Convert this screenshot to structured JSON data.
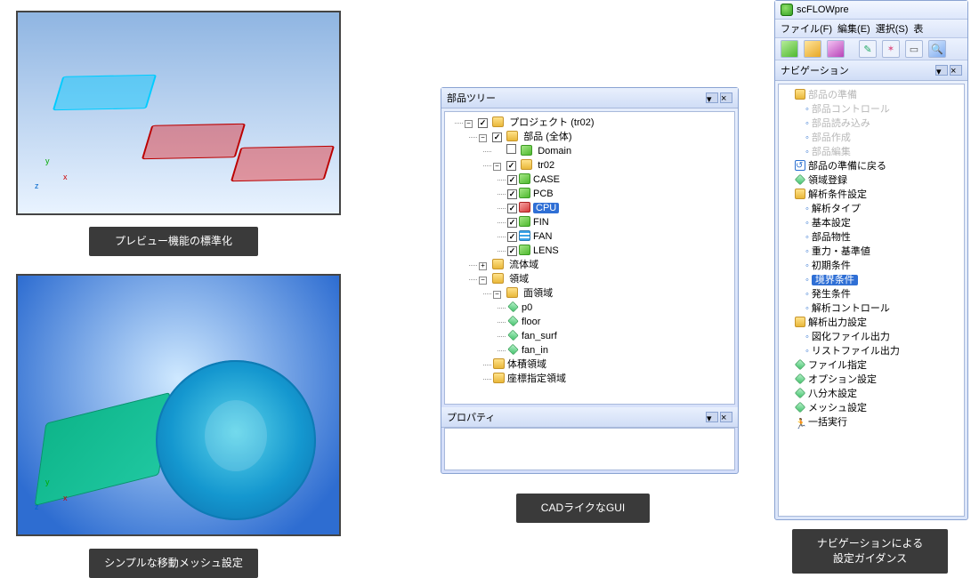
{
  "captions": {
    "preview": "プレビュー機能の標準化",
    "mesh": "シンプルな移動メッシュ設定",
    "cad": "CADライクなGUI",
    "nav": "ナビゲーションによる\n設定ガイダンス"
  },
  "tree_window": {
    "title": "部品ツリー",
    "property_title": "プロパティ",
    "root": {
      "label": "プロジェクト (tr02)",
      "checked": true,
      "children": {
        "parts": {
          "label": "部品 (全体)",
          "checked": true,
          "items": [
            {
              "label": "Domain",
              "checked": false,
              "icon": "cube"
            },
            {
              "label": "tr02",
              "checked": true,
              "icon": "folder",
              "children": [
                {
                  "label": "CASE",
                  "checked": true,
                  "icon": "cube"
                },
                {
                  "label": "PCB",
                  "checked": true,
                  "icon": "cube"
                },
                {
                  "label": "CPU",
                  "checked": true,
                  "icon": "cube.red",
                  "selected": true
                },
                {
                  "label": "FIN",
                  "checked": true,
                  "icon": "cube"
                },
                {
                  "label": "FAN",
                  "checked": true,
                  "icon": "wave"
                },
                {
                  "label": "LENS",
                  "checked": true,
                  "icon": "cube"
                }
              ]
            }
          ]
        },
        "fluid": {
          "label": "流体域"
        },
        "region": {
          "label": "領域",
          "surface": {
            "label": "面領域",
            "items": [
              {
                "label": "p0"
              },
              {
                "label": "floor"
              },
              {
                "label": "fan_surf"
              },
              {
                "label": "fan_in"
              }
            ]
          },
          "volume": {
            "label": "体積領域"
          },
          "coord": {
            "label": "座標指定領域"
          }
        }
      }
    }
  },
  "nav_window": {
    "app_title": "scFLOWpre",
    "menu": [
      "ファイル(F)",
      "編集(E)",
      "選択(S)",
      "表"
    ],
    "panel_title": "ナビゲーション",
    "items": [
      {
        "label": "部品の準備",
        "icon": "folder",
        "dim": true,
        "children": [
          {
            "label": "部品コントロール",
            "bullet": true,
            "dim": true
          },
          {
            "label": "部品読み込み",
            "bullet": true,
            "dim": true
          },
          {
            "label": "部品作成",
            "bullet": true,
            "dim": true
          },
          {
            "label": "部品編集",
            "bullet": true,
            "dim": true
          }
        ]
      },
      {
        "label": "部品の準備に戻る",
        "icon": "back"
      },
      {
        "label": "領域登録",
        "icon": "diamond"
      },
      {
        "label": "解析条件設定",
        "icon": "folder",
        "children": [
          {
            "label": "解析タイプ",
            "bullet": true
          },
          {
            "label": "基本設定",
            "bullet": true
          },
          {
            "label": "部品物性",
            "bullet": true
          },
          {
            "label": "重力・基準値",
            "bullet": true
          },
          {
            "label": "初期条件",
            "bullet": true
          },
          {
            "label": "境界条件",
            "bullet": true,
            "selected": true
          },
          {
            "label": "発生条件",
            "bullet": true
          },
          {
            "label": "解析コントロール",
            "bullet": true
          }
        ]
      },
      {
        "label": "解析出力設定",
        "icon": "folder",
        "children": [
          {
            "label": "図化ファイル出力",
            "bullet": true
          },
          {
            "label": "リストファイル出力",
            "bullet": true
          }
        ]
      },
      {
        "label": "ファイル指定",
        "icon": "diamond"
      },
      {
        "label": "オプション設定",
        "icon": "diamond"
      },
      {
        "label": "八分木設定",
        "icon": "diamond"
      },
      {
        "label": "メッシュ設定",
        "icon": "diamond"
      },
      {
        "label": "一括実行",
        "icon": "run"
      }
    ]
  }
}
